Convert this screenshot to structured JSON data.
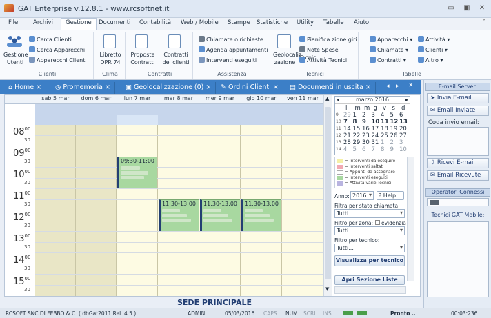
{
  "window": {
    "title": "GAT Enterprise v.12.8.1 - www.rcsoftnet.it"
  },
  "menu": [
    "File",
    "Archivi",
    "Gestione",
    "Documenti",
    "Contabilità",
    "Web / Mobile",
    "Stampe",
    "Statistiche",
    "Utility",
    "Tabelle",
    "Aiuto"
  ],
  "ribbon": {
    "gestione_utenti": "Gestione Utenti",
    "clienti_label": "Clienti",
    "cerca_clienti": "Cerca Clienti",
    "cerca_apparecchi": "Cerca Apparecchi",
    "apparecchi_clienti": "Apparecchi Clienti",
    "libretto": "Libretto DPR 74",
    "clima_label": "Clima",
    "proposte": "Proposte Contratti",
    "contratti_clienti": "Contratti dei clienti",
    "contratti_label": "Contratti",
    "chiamate": "Chiamate o richieste",
    "agenda": "Agenda appuntamenti",
    "interventi": "Interventi eseguiti",
    "assistenza_label": "Assistenza",
    "geolocalizzazione": "Geolocaliz zazione",
    "pianifica": "Pianifica zione giri",
    "note_spese": "Note Spese Tecnici",
    "attivita_tecnici": "Attività Tecnici",
    "tecnici_label": "Tecnici",
    "apparecchi": "Apparecchi",
    "chiamate_t": "Chiamate",
    "contratti_t": "Contratti",
    "attivita_t": "Attività",
    "clienti_t": "Clienti",
    "altro_t": "Altro",
    "tabelle_label": "Tabelle"
  },
  "tabs": [
    "Home",
    "Promemoria",
    "Geolocalizzazione (0)",
    "Ordini Clienti",
    "Documenti in uscita"
  ],
  "calendar": {
    "days": [
      "sab 5 mar",
      "dom 6 mar",
      "lun 7 mar",
      "mar 8 mar",
      "mer 9 mar",
      "gio 10 mar",
      "ven 11 mar"
    ],
    "hours": [
      "08",
      "09",
      "10",
      "11",
      "12",
      "13",
      "14",
      "15"
    ],
    "minutes_full": "00",
    "minutes_half": "30",
    "appointments": [
      {
        "time": "09:30-11:00"
      },
      {
        "time": "11:30-13:00"
      },
      {
        "time": "11:30-13:00"
      },
      {
        "time": "11:30-13:00"
      }
    ]
  },
  "footer": "SEDE PRINCIPALE",
  "minical": {
    "month": "marzo 2016",
    "weekdays": [
      "l",
      "m",
      "m",
      "g",
      "v",
      "s",
      "d"
    ],
    "weeks": [
      {
        "n": "9",
        "d": [
          "29",
          "1",
          "2",
          "3",
          "4",
          "5",
          "6"
        ]
      },
      {
        "n": "10",
        "d": [
          "7",
          "8",
          "9",
          "10",
          "11",
          "12",
          "13"
        ]
      },
      {
        "n": "11",
        "d": [
          "14",
          "15",
          "16",
          "17",
          "18",
          "19",
          "20"
        ]
      },
      {
        "n": "12",
        "d": [
          "21",
          "22",
          "23",
          "24",
          "25",
          "26",
          "27"
        ]
      },
      {
        "n": "13",
        "d": [
          "28",
          "29",
          "30",
          "31",
          "1",
          "2",
          "3"
        ]
      },
      {
        "n": "14",
        "d": [
          "4",
          "5",
          "6",
          "7",
          "8",
          "9",
          "10"
        ]
      }
    ]
  },
  "legend": [
    {
      "label": "= Interventi da eseguire",
      "color": "#f5f0a8"
    },
    {
      "label": "= Interventi saltati",
      "color": "#f2a9b3"
    },
    {
      "label": "= Appunt. da assegnare",
      "color": "#ffffff"
    },
    {
      "label": "= Interventi eseguiti",
      "color": "#a8d8a0"
    },
    {
      "label": "= Attività varie Tecnici",
      "color": "#b9b4e0"
    }
  ],
  "filters": {
    "anno_label": "Anno:",
    "anno_value": "2016",
    "help": "Help",
    "stato_label": "Filtra per stato chiamata:",
    "stato_value": "Tutti...",
    "zona_label": "Filtro per zona:",
    "evidenzia": "evidenzia",
    "zona_value": "Tutti...",
    "tecnico_label": "Filtro per tecnico:",
    "tecnico_value": "Tutti...",
    "visualizza": "Visualizza per tecnico",
    "apri_sezione": "Apri Sezione Liste"
  },
  "right": {
    "email_server": "E-mail Server:",
    "invia": "Invia E-mail",
    "inviate": "Email Inviate",
    "coda": "Coda invio email:",
    "ricevi": "Ricevi E-mail",
    "ricevute": "Email Ricevute",
    "operatori": "Operatori Connessi",
    "tecnici_mobile": "Tecnici GAT Mobile:"
  },
  "status": {
    "company": "RCSOFT SNC DI FEBBO & C.  ( dbGat2011 Rel. 4.5 )",
    "user": "ADMIN",
    "date": "05/03/2016",
    "caps": "CAPS",
    "num": "NUM",
    "scrl": "SCRL",
    "ins": "INS",
    "pronto": "Pronto ..",
    "clock": "00:03:236"
  },
  "colors": {
    "accent": "#3c7fc7",
    "appt_done": "#a8d8a0",
    "weekend": "#e9e6c6",
    "weekday": "#fdfbe3"
  }
}
